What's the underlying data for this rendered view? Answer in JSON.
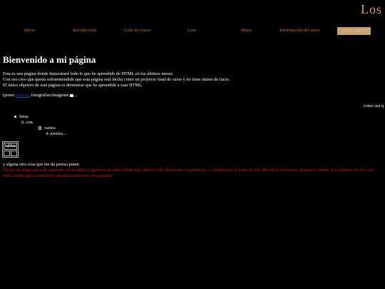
{
  "header": {
    "logo_text": "Los"
  },
  "nav": {
    "items": [
      {
        "label": "Inicio"
      },
      {
        "label": "Introducción"
      },
      {
        "label": "Guía de clases"
      },
      {
        "label": "Lore"
      },
      {
        "label": "Mapa"
      },
      {
        "label": "Información del autor"
      },
      {
        "label": "DESCARGA"
      }
    ],
    "active_index": 6,
    "colors": {
      "link": "#b07a50",
      "active_bg": "#c9a070"
    }
  },
  "main": {
    "title": "Bienvenido a mi página",
    "intro_lines": [
      "Esta es una página donde demostraré todo lo que he aprendido de HTML en los últimos meses.",
      "Con eso creo que queda sobreentendido que esta página está hecha como un proyecto final de curso y no tiene ánimo de lucro.",
      "El único objetivo de esta página es demostrar que he aprendido a usar HTML."
    ],
    "poner_prefix": "(poner ",
    "poner_link": "enlaces",
    "poner_suffix": ", fotografías/imágenes",
    "poner_end": "...",
    "marquee_text": "como sea q",
    "list": {
      "item1": "listas",
      "item2": "ii. con",
      "item3": "varios",
      "item4": "4. niveles..."
    },
    "table": {
      "header": "tablas",
      "cells": [
        "",
        ""
      ]
    },
    "alguna": "y alguna otra cosa que me da pereza poner.",
    "red_note": "Un par de notas antes de empezar, en las tablas y galerías de fotos donde hay enlaces solo funcionan los primeros, y cuando leas la parte de info del autor, lectu lota, aunque te enerte, a, si quieres sin otro, no utilices más que la mitad del salto para moverte por esa parte."
  }
}
